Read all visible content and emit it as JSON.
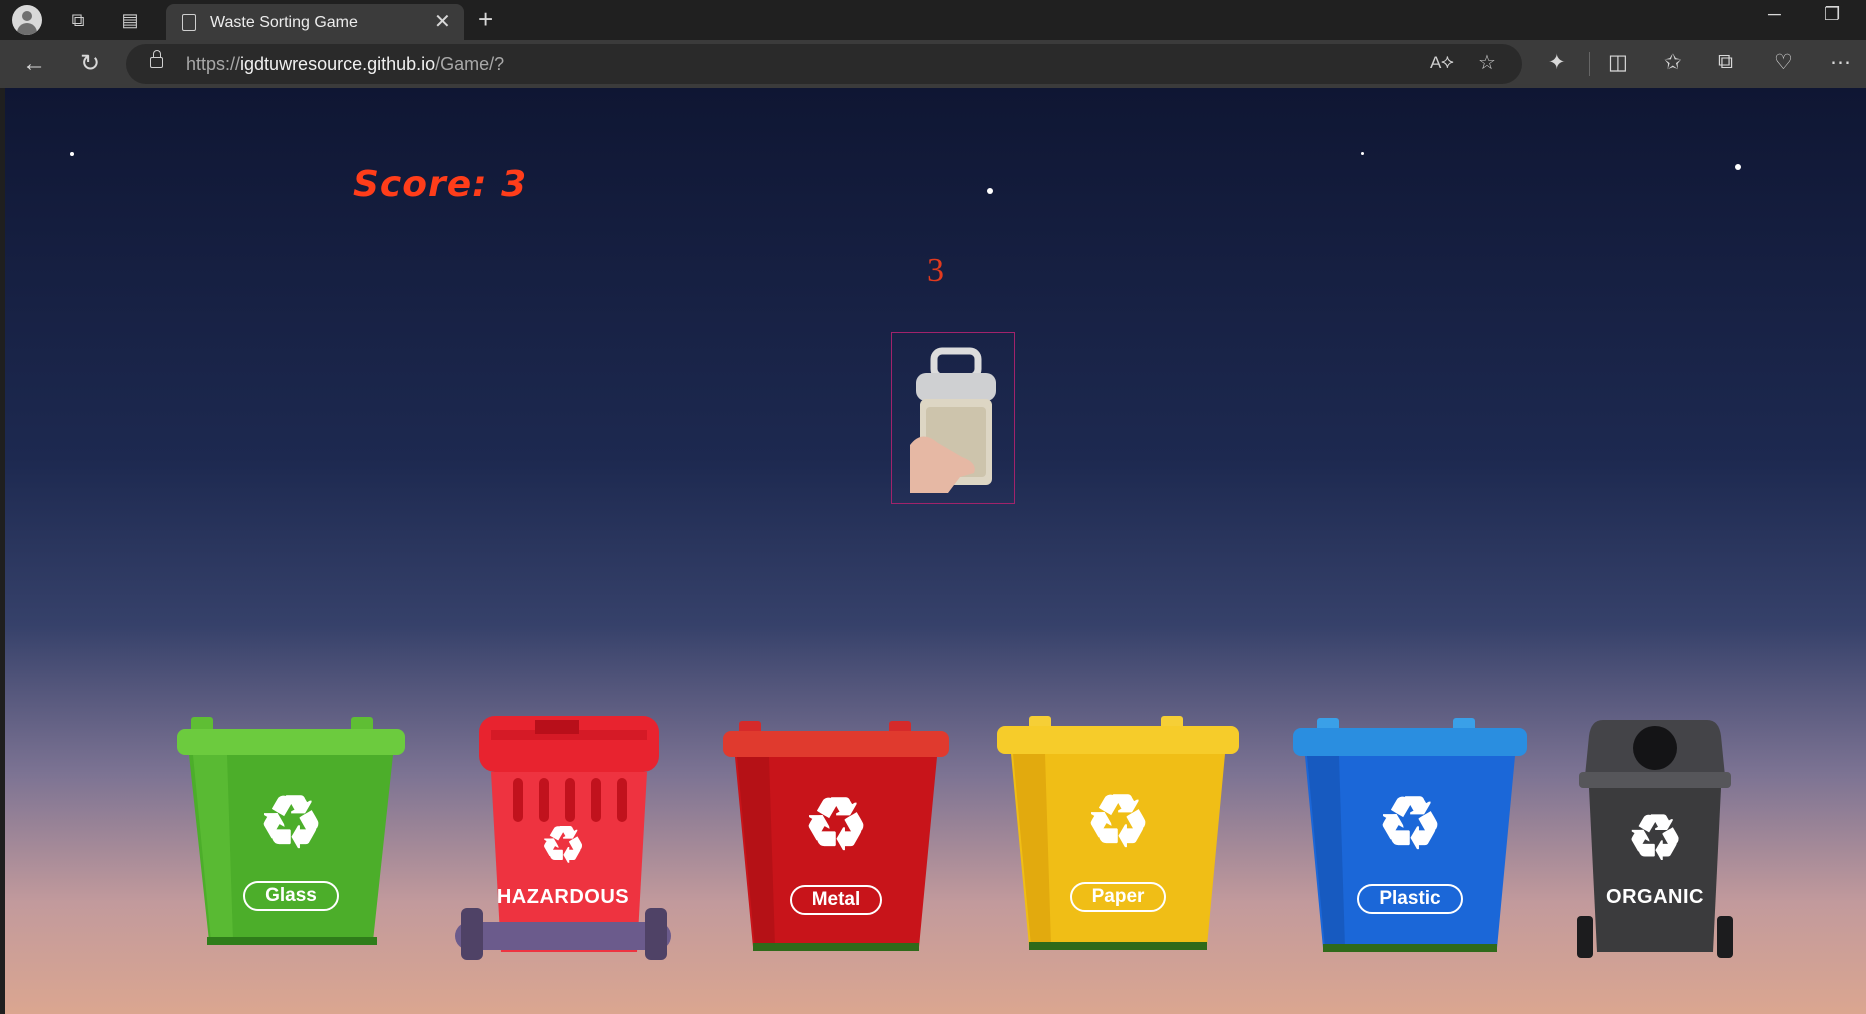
{
  "browser": {
    "tab_title": "Waste Sorting Game",
    "url_prefix": "https://",
    "url_host": "igdtuwresource.github.io",
    "url_path": "/Game/?"
  },
  "game": {
    "score_label": "Score: 3",
    "countdown": "3",
    "current_item": "plastic-container-image",
    "bins": [
      {
        "label": "Glass",
        "color": "#4cae2a",
        "style": "pill"
      },
      {
        "label": "HAZARDOUS",
        "color": "#e8232f",
        "style": "plain"
      },
      {
        "label": "Metal",
        "color": "#c8141a",
        "style": "pill"
      },
      {
        "label": "Paper",
        "color": "#f0be16",
        "style": "pill"
      },
      {
        "label": "Plastic",
        "color": "#1b67d8",
        "style": "pill"
      },
      {
        "label": "ORGANIC",
        "color": "#3b3b3d",
        "style": "plain"
      }
    ]
  },
  "colors": {
    "score": "#ff3d1a",
    "countdown": "#e23a1e",
    "item_border": "#a1236b"
  }
}
